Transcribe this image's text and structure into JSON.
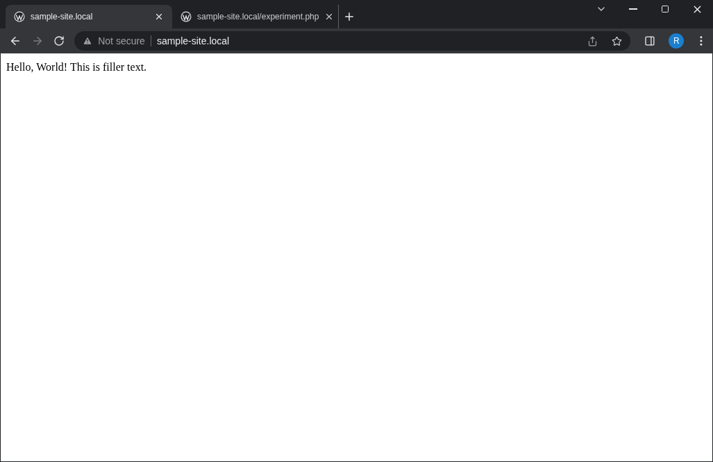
{
  "tabs": [
    {
      "title": "sample-site.local",
      "selected": true
    },
    {
      "title": "sample-site.local/experiment.php",
      "selected": false
    }
  ],
  "toolbar": {
    "back_disabled": false,
    "forward_disabled": true
  },
  "address_bar": {
    "security": "Not secure",
    "url": "sample-site.local"
  },
  "profile": {
    "initial": "R"
  },
  "page": {
    "text": "Hello, World! This is filler text."
  }
}
